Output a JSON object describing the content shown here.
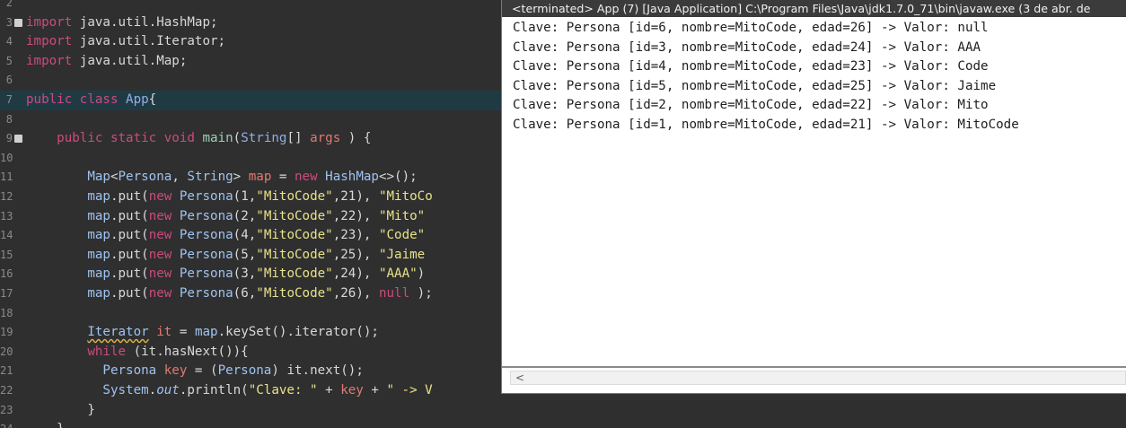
{
  "console": {
    "title": "<terminated> App (7) [Java Application] C:\\Program Files\\Java\\jdk1.7.0_71\\bin\\javaw.exe (3 de abr. de",
    "output": [
      "Clave: Persona [id=6, nombre=MitoCode, edad=26] -> Valor: null",
      "Clave: Persona [id=3, nombre=MitoCode, edad=24] -> Valor: AAA",
      "Clave: Persona [id=4, nombre=MitoCode, edad=23] -> Valor: Code",
      "Clave: Persona [id=5, nombre=MitoCode, edad=25] -> Valor: Jaime",
      "Clave: Persona [id=2, nombre=MitoCode, edad=22] -> Valor: Mito",
      "Clave: Persona [id=1, nombre=MitoCode, edad=21] -> Valor: MitoCode"
    ],
    "scroll_left_arrow": "<"
  },
  "editor": {
    "lines": [
      {
        "num": "2"
      },
      {
        "num": "3",
        "fold": true,
        "tokens": [
          [
            "kw",
            "import"
          ],
          [
            "",
            "java.util.HashMap;"
          ]
        ]
      },
      {
        "num": "4",
        "tokens": [
          [
            "kw",
            "import"
          ],
          [
            "",
            "java.util.Iterator;"
          ]
        ]
      },
      {
        "num": "5",
        "tokens": [
          [
            "kw",
            "import"
          ],
          [
            "",
            "java.util.Map;"
          ]
        ]
      },
      {
        "num": "6"
      },
      {
        "num": "7",
        "current": true,
        "tokens": [
          [
            "kw",
            "public"
          ],
          [
            "kw",
            "class"
          ],
          [
            "ty",
            "App"
          ],
          [
            "",
            "{"
          ]
        ]
      },
      {
        "num": "8"
      },
      {
        "num": "9",
        "fold": true,
        "tokens": [
          [
            "",
            "    "
          ],
          [
            "kw",
            "public"
          ],
          [
            "kw",
            "static"
          ],
          [
            "kw",
            "void"
          ],
          [
            "fn",
            "main"
          ],
          [
            "",
            "("
          ],
          [
            "ty",
            "String"
          ],
          [
            "",
            "[] "
          ],
          [
            "nm",
            "args"
          ],
          [
            "",
            " ) {"
          ]
        ]
      },
      {
        "num": "10"
      },
      {
        "num": "11",
        "tokens": [
          [
            "",
            "        "
          ],
          [
            "ty2",
            "Map"
          ],
          [
            "",
            "<"
          ],
          [
            "ty2",
            "Persona"
          ],
          [
            "",
            ", "
          ],
          [
            "ty2",
            "String"
          ],
          [
            "",
            "> "
          ],
          [
            "nm",
            "map"
          ],
          [
            "",
            " = "
          ],
          [
            "kw",
            "new"
          ],
          [
            "ty2",
            "HashMap"
          ],
          [
            "",
            "<>();"
          ]
        ]
      },
      {
        "num": "12",
        "tokens": [
          [
            "",
            "        "
          ],
          [
            "ty2",
            "map"
          ],
          [
            "",
            ".put("
          ],
          [
            "kw",
            "new"
          ],
          [
            "ty2",
            "Persona"
          ],
          [
            "",
            "(1,"
          ],
          [
            "str",
            "\"MitoCode\""
          ],
          [
            "",
            ",21), "
          ],
          [
            "str",
            "\"MitoCo"
          ]
        ]
      },
      {
        "num": "13",
        "tokens": [
          [
            "",
            "        "
          ],
          [
            "ty2",
            "map"
          ],
          [
            "",
            ".put("
          ],
          [
            "kw",
            "new"
          ],
          [
            "ty2",
            "Persona"
          ],
          [
            "",
            "(2,"
          ],
          [
            "str",
            "\"MitoCode\""
          ],
          [
            "",
            ",22), "
          ],
          [
            "str",
            "\"Mito\""
          ]
        ]
      },
      {
        "num": "14",
        "tokens": [
          [
            "",
            "        "
          ],
          [
            "ty2",
            "map"
          ],
          [
            "",
            ".put("
          ],
          [
            "kw",
            "new"
          ],
          [
            "ty2",
            "Persona"
          ],
          [
            "",
            "(4,"
          ],
          [
            "str",
            "\"MitoCode\""
          ],
          [
            "",
            ",23), "
          ],
          [
            "str",
            "\"Code\""
          ]
        ]
      },
      {
        "num": "15",
        "tokens": [
          [
            "",
            "        "
          ],
          [
            "ty2",
            "map"
          ],
          [
            "",
            ".put("
          ],
          [
            "kw",
            "new"
          ],
          [
            "ty2",
            "Persona"
          ],
          [
            "",
            "(5,"
          ],
          [
            "str",
            "\"MitoCode\""
          ],
          [
            "",
            ",25), "
          ],
          [
            "str",
            "\"Jaime"
          ]
        ]
      },
      {
        "num": "16",
        "tokens": [
          [
            "",
            "        "
          ],
          [
            "ty2",
            "map"
          ],
          [
            "",
            ".put("
          ],
          [
            "kw",
            "new"
          ],
          [
            "ty2",
            "Persona"
          ],
          [
            "",
            "(3,"
          ],
          [
            "str",
            "\"MitoCode\""
          ],
          [
            "",
            ",24), "
          ],
          [
            "str",
            "\"AAA\""
          ],
          [
            "",
            ")"
          ]
        ]
      },
      {
        "num": "17",
        "tokens": [
          [
            "",
            "        "
          ],
          [
            "ty2",
            "map"
          ],
          [
            "",
            ".put("
          ],
          [
            "kw",
            "new"
          ],
          [
            "ty2",
            "Persona"
          ],
          [
            "",
            "(6,"
          ],
          [
            "str",
            "\"MitoCode\""
          ],
          [
            "",
            ",26), "
          ],
          [
            "kw",
            "null"
          ],
          [
            "",
            ");"
          ]
        ]
      },
      {
        "num": "18"
      },
      {
        "num": "19",
        "tokens": [
          [
            "",
            "        "
          ],
          [
            "ty2 warn",
            "Iterator"
          ],
          [
            "",
            " "
          ],
          [
            "nm",
            "it"
          ],
          [
            "",
            " = "
          ],
          [
            "ty2",
            "map"
          ],
          [
            "",
            ".keySet().iterator();"
          ]
        ]
      },
      {
        "num": "20",
        "tokens": [
          [
            "",
            "        "
          ],
          [
            "kw",
            "while"
          ],
          [
            "",
            "(it.hasNext()){"
          ]
        ]
      },
      {
        "num": "21",
        "tokens": [
          [
            "",
            "          "
          ],
          [
            "ty2",
            "Persona"
          ],
          [
            "",
            " "
          ],
          [
            "nm",
            "key"
          ],
          [
            "",
            " = ("
          ],
          [
            "ty2",
            "Persona"
          ],
          [
            "",
            ") it.next();"
          ]
        ]
      },
      {
        "num": "22",
        "tokens": [
          [
            "",
            "          "
          ],
          [
            "ty2",
            "System"
          ],
          [
            "",
            "."
          ],
          [
            "ty2 it",
            "out"
          ],
          [
            "",
            ".println("
          ],
          [
            "str",
            "\"Clave: \""
          ],
          [
            "",
            " + "
          ],
          [
            "nm",
            "key"
          ],
          [
            "",
            " + "
          ],
          [
            "str",
            "\" -> V"
          ]
        ]
      },
      {
        "num": "23",
        "tokens": [
          [
            "",
            "        }"
          ]
        ]
      },
      {
        "num": "24",
        "tokens": [
          [
            "",
            "    }"
          ]
        ]
      }
    ]
  },
  "colors": {
    "editor_bg": "#2f2f2f",
    "keyword": "#cc4a7e",
    "type": "#9fc3f0",
    "string": "#e8e28a",
    "variable": "#e07a72",
    "method": "#9fd0b8",
    "console_bg": "#ffffff",
    "console_title_bg": "#3b3b3b"
  }
}
